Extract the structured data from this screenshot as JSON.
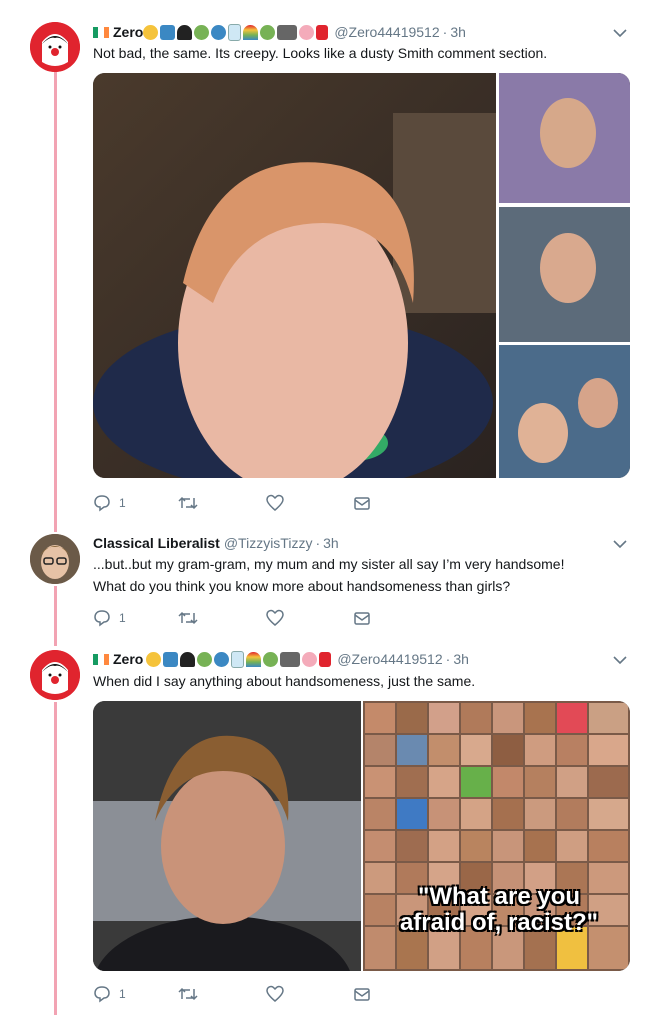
{
  "tweets": [
    {
      "name": "Zero",
      "handle": "@Zero44419512",
      "time": "3h",
      "text": "Not bad, the same. Its creepy. Looks like a dusty Smith comment section.",
      "reply_count": "1",
      "media_caption": ""
    },
    {
      "name": "Classical Liberalist",
      "handle": "@TizzyisTizzy",
      "time": "3h",
      "text_line1": "...but..but my gram-gram, my mum and my sister all say I’m very handsome!",
      "text_line2": "What do you think you know more about handsomeness than girls?",
      "reply_count": "1"
    },
    {
      "name": "Zero",
      "handle": "@Zero44419512",
      "time": "3h",
      "text": "When did I say anything about handsomeness, just the same.",
      "reply_count": "1",
      "media_caption_line1": "\"What are you",
      "media_caption_line2": "afraid of, racist?\""
    }
  ],
  "separator_dot": "·",
  "icons": [
    "reply-icon",
    "retweet-icon",
    "like-icon",
    "message-icon",
    "chevron-down-icon"
  ],
  "colors": {
    "thread_line": "#f2a3b3",
    "muted": "#657786",
    "text": "#14171a",
    "avatar_red": "#e0242e"
  }
}
